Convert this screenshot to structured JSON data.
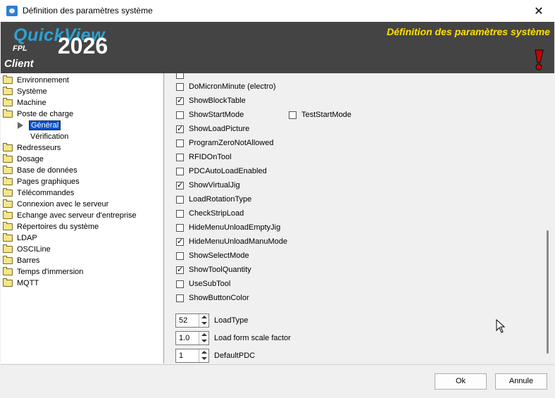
{
  "window": {
    "title": "Définition des paramètres système"
  },
  "banner": {
    "brand": "QuickView",
    "fpl": "FPL",
    "year": "2026",
    "client": "Client",
    "title": "Définition des paramètres système",
    "colors": {
      "brand": "#2aa3d6",
      "title": "#ffe000",
      "background": "#444444"
    }
  },
  "tree": {
    "items": [
      {
        "label": "Environnement"
      },
      {
        "label": "Système"
      },
      {
        "label": "Machine"
      },
      {
        "label": "Poste de charge"
      },
      {
        "label": "Général",
        "selected": true
      },
      {
        "label": "Vérification"
      },
      {
        "label": "Redresseurs"
      },
      {
        "label": "Dosage"
      },
      {
        "label": "Base de données"
      },
      {
        "label": "Pages graphiques"
      },
      {
        "label": "Télécommandes"
      },
      {
        "label": "Connexion avec le serveur"
      },
      {
        "label": "Echange avec serveur d'entreprise"
      },
      {
        "label": "Répertoires du système"
      },
      {
        "label": "LDAP"
      },
      {
        "label": "OSCILine"
      },
      {
        "label": "Barres"
      },
      {
        "label": "Temps d'immersion"
      },
      {
        "label": "MQTT"
      }
    ]
  },
  "options": {
    "checkboxes": [
      {
        "label": "DoMicronMinute (electro)",
        "checked": false
      },
      {
        "label": "ShowBlockTable",
        "checked": true
      },
      {
        "label": "ShowStartMode",
        "checked": false
      },
      {
        "label": "ShowLoadPicture",
        "checked": true
      },
      {
        "label": "ProgramZeroNotAllowed",
        "checked": false
      },
      {
        "label": "RFIDOnTool",
        "checked": false
      },
      {
        "label": "PDCAutoLoadEnabled",
        "checked": false
      },
      {
        "label": "ShowVirtualJig",
        "checked": true
      },
      {
        "label": "LoadRotationType",
        "checked": false
      },
      {
        "label": "CheckStripLoad",
        "checked": false
      },
      {
        "label": "HideMenuUnloadEmptyJig",
        "checked": false
      },
      {
        "label": "HideMenuUnloadManuMode",
        "checked": true
      },
      {
        "label": "ShowSelectMode",
        "checked": false
      },
      {
        "label": "ShowToolQuantity",
        "checked": true
      },
      {
        "label": "UseSubTool",
        "checked": false
      },
      {
        "label": "ShowButtonColor",
        "checked": false
      }
    ],
    "test_start_mode": {
      "label": "TestStartMode",
      "checked": false
    },
    "spinners": [
      {
        "value": "52",
        "label": "LoadType"
      },
      {
        "value": "1.0",
        "label": "Load form scale factor"
      },
      {
        "value": "1",
        "label": "DefaultPDC"
      }
    ]
  },
  "buttons": {
    "ok": "Ok",
    "cancel": "Annule"
  }
}
